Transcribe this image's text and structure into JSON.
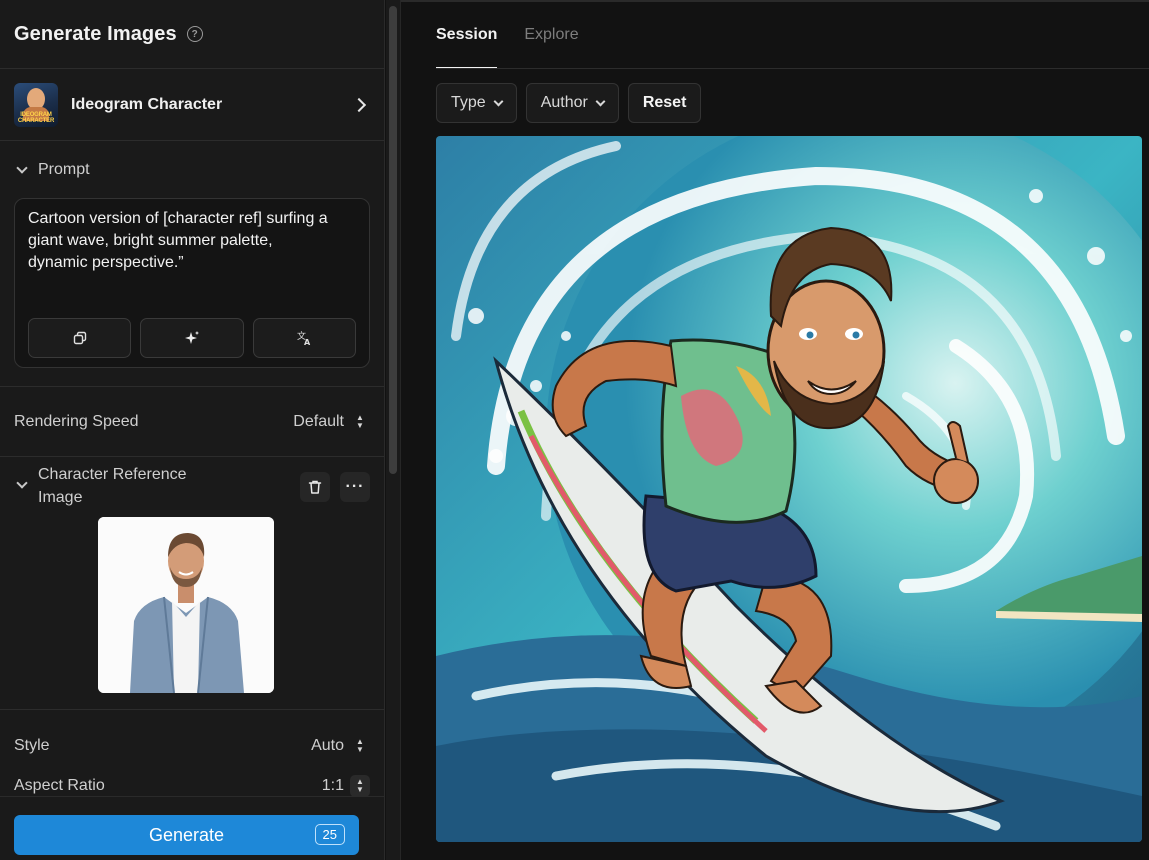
{
  "sidebar": {
    "title": "Generate Images",
    "help_icon": "?",
    "model": {
      "name": "Ideogram Character",
      "thumb_text": "IDEOGRAM CHARACTER"
    },
    "prompt": {
      "label": "Prompt",
      "text": "Cartoon version of [character ref] surfing a giant wave, bright summer palette, dynamic perspective.”",
      "tools": [
        "copy-icon",
        "magic-sparkle-icon",
        "translate-icon"
      ]
    },
    "rendering_speed": {
      "label": "Rendering Speed",
      "value": "Default"
    },
    "character_reference": {
      "label": "Character Reference Image"
    },
    "style": {
      "label": "Style",
      "value": "Auto"
    },
    "aspect_ratio": {
      "label": "Aspect Ratio",
      "value": "1:1"
    },
    "generate": {
      "label": "Generate",
      "count": "25"
    }
  },
  "main": {
    "tabs": [
      {
        "label": "Session",
        "active": true
      },
      {
        "label": "Explore",
        "active": false
      }
    ],
    "filters": {
      "type_label": "Type",
      "author_label": "Author",
      "reset_label": "Reset"
    }
  },
  "colors": {
    "accent": "#1e88d8",
    "background": "#121212",
    "panel": "#1a1a1a"
  }
}
